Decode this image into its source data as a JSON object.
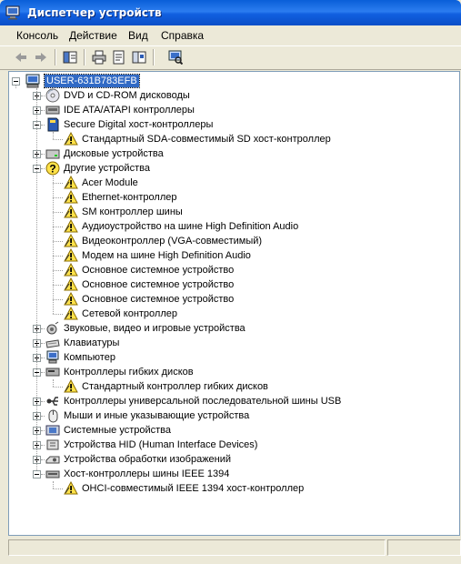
{
  "window": {
    "title": "Диспетчер устройств"
  },
  "menu": [
    "Консоль",
    "Действие",
    "Вид",
    "Справка"
  ],
  "toolbar": {
    "buttons": [
      "back-arrow-icon",
      "forward-arrow-icon",
      "console-tree-icon",
      "print-icon",
      "properties-icon",
      "help-icon",
      "scan-hardware-icon"
    ]
  },
  "tree": {
    "root": "USER-631B783EFB",
    "nodes": [
      {
        "label": "DVD и CD-ROM дисководы",
        "icon": "cdrom-icon",
        "expanded": false
      },
      {
        "label": "IDE ATA/ATAPI контроллеры",
        "icon": "ide-controller-icon",
        "expanded": false
      },
      {
        "label": "Secure Digital хост-контроллеры",
        "icon": "sd-host-icon",
        "expanded": true,
        "children": [
          {
            "label": "Стандартный SDA-совместимый SD хост-контроллер",
            "icon": "warning-device-icon"
          }
        ]
      },
      {
        "label": "Дисковые устройства",
        "icon": "disk-drive-icon",
        "expanded": false
      },
      {
        "label": "Другие устройства",
        "icon": "unknown-device-icon",
        "expanded": true,
        "children": [
          {
            "label": "Acer Module",
            "icon": "warning-device-icon"
          },
          {
            "label": "Ethernet-контроллер",
            "icon": "warning-device-icon"
          },
          {
            "label": "SM контроллер шины",
            "icon": "warning-device-icon"
          },
          {
            "label": "Аудиоустройство на шине High Definition Audio",
            "icon": "warning-device-icon"
          },
          {
            "label": "Видеоконтроллер (VGA-совместимый)",
            "icon": "warning-device-icon"
          },
          {
            "label": "Модем на шине High Definition Audio",
            "icon": "warning-device-icon"
          },
          {
            "label": "Основное системное устройство",
            "icon": "warning-device-icon"
          },
          {
            "label": "Основное системное устройство",
            "icon": "warning-device-icon"
          },
          {
            "label": "Основное системное устройство",
            "icon": "warning-device-icon"
          },
          {
            "label": "Сетевой контроллер",
            "icon": "warning-device-icon"
          }
        ]
      },
      {
        "label": "Звуковые, видео и игровые устройства",
        "icon": "sound-icon",
        "expanded": false
      },
      {
        "label": "Клавиатуры",
        "icon": "keyboard-icon",
        "expanded": false
      },
      {
        "label": "Компьютер",
        "icon": "computer-icon",
        "expanded": false
      },
      {
        "label": "Контроллеры гибких дисков",
        "icon": "floppy-controller-icon",
        "expanded": true,
        "children": [
          {
            "label": "Стандартный контроллер гибких дисков",
            "icon": "warning-device-icon"
          }
        ]
      },
      {
        "label": "Контроллеры универсальной последовательной шины USB",
        "icon": "usb-icon",
        "expanded": false
      },
      {
        "label": "Мыши и иные указывающие устройства",
        "icon": "mouse-icon",
        "expanded": false
      },
      {
        "label": "Системные устройства",
        "icon": "system-device-icon",
        "expanded": false
      },
      {
        "label": "Устройства HID (Human Interface Devices)",
        "icon": "hid-icon",
        "expanded": false
      },
      {
        "label": "Устройства обработки изображений",
        "icon": "imaging-icon",
        "expanded": false
      },
      {
        "label": "Хост-контроллеры шины IEEE 1394",
        "icon": "ieee1394-icon",
        "expanded": true,
        "children": [
          {
            "label": "OHCI-совместимый IEEE 1394 хост-контроллер",
            "icon": "warning-device-icon"
          }
        ]
      }
    ]
  },
  "colors": {
    "selection": "#316ac5",
    "title_bar": "#0a5fd8",
    "window_bg": "#ece9d8"
  }
}
